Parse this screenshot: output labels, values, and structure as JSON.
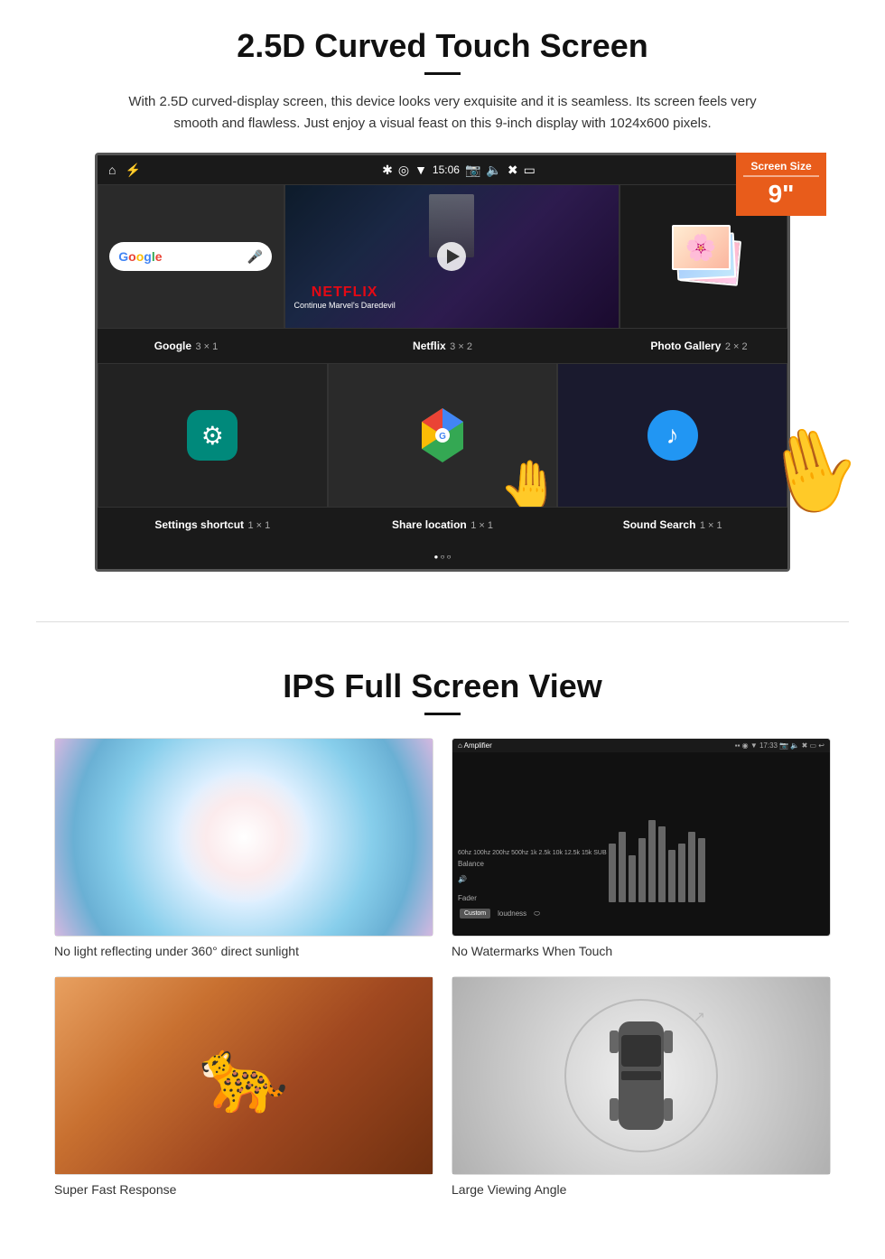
{
  "section1": {
    "title": "2.5D Curved Touch Screen",
    "description": "With 2.5D curved-display screen, this device looks very exquisite and it is seamless. Its screen feels very smooth and flawless. Just enjoy a visual feast on this 9-inch display with 1024x600 pixels.",
    "badge": {
      "label": "Screen Size",
      "size": "9\""
    },
    "statusbar": {
      "time": "15:06"
    },
    "apps_row1": [
      {
        "name": "Google",
        "size": "3 × 1"
      },
      {
        "name": "Netflix",
        "size": "3 × 2"
      },
      {
        "name": "Photo Gallery",
        "size": "2 × 2"
      }
    ],
    "apps_row2": [
      {
        "name": "Settings shortcut",
        "size": "1 × 1"
      },
      {
        "name": "Share location",
        "size": "1 × 1"
      },
      {
        "name": "Sound Search",
        "size": "1 × 1"
      }
    ],
    "netflix": {
      "brand": "NETFLIX",
      "subtitle": "Continue Marvel's Daredevil"
    }
  },
  "section2": {
    "title": "IPS Full Screen View",
    "features": [
      {
        "caption": "No light reflecting under 360° direct sunlight"
      },
      {
        "caption": "No Watermarks When Touch"
      },
      {
        "caption": "Super Fast Response"
      },
      {
        "caption": "Large Viewing Angle"
      }
    ]
  }
}
